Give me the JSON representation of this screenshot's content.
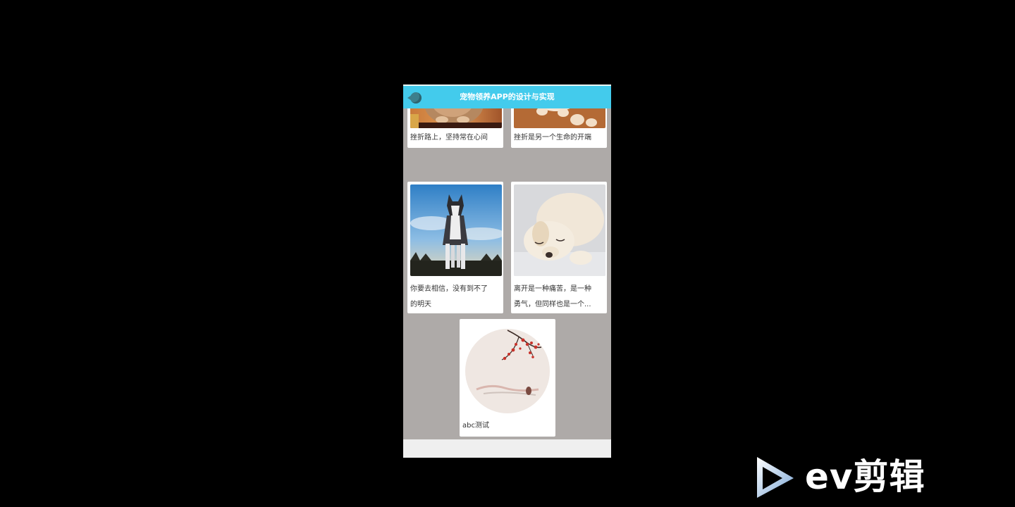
{
  "header": {
    "title": "宠物领养APP的设计与实现"
  },
  "cards": [
    {
      "caption": "挫折路上，坚持常在心间",
      "image": "cat-sitting"
    },
    {
      "caption": "挫折是另一个生命的开端",
      "image": "puppy-on-log"
    },
    {
      "caption": "你要去相信，没有到不了的明天",
      "caption_line1": "你要去相信，没有到不了",
      "caption_line2": "的明天",
      "image": "husky-dog"
    },
    {
      "caption_line1": "离开是一种痛苦，是一种",
      "caption_line2": "勇气，但同样也是一个...",
      "image": "sleeping-puppy"
    },
    {
      "caption": "abc测试",
      "image": "plum-blossom-painting"
    }
  ],
  "watermark": {
    "text": "ev剪辑"
  },
  "colors": {
    "header": "#43cbec",
    "background": "#aeaaa8",
    "page": "#000000"
  }
}
